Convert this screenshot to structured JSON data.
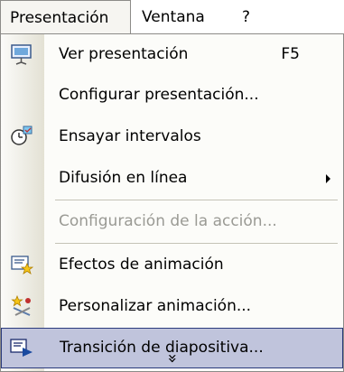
{
  "menubar": {
    "items": [
      {
        "label": "Presentación"
      },
      {
        "label": "Ventana"
      },
      {
        "label": "?"
      }
    ]
  },
  "menu": {
    "items": [
      {
        "label": "Ver presentación",
        "shortcut": "F5",
        "icon": "slideshow-icon"
      },
      {
        "label": "Configurar presentación..."
      },
      {
        "label": "Ensayar intervalos",
        "icon": "rehearse-timings-icon"
      },
      {
        "label": "Difusión en línea",
        "submenu": true
      },
      {
        "label": "Configuración de la acción...",
        "disabled": true
      },
      {
        "label": "Efectos de animación",
        "icon": "animation-effects-icon"
      },
      {
        "label": "Personalizar animación...",
        "icon": "custom-animation-icon"
      },
      {
        "label": "Transición de diapositiva...",
        "icon": "slide-transition-icon",
        "highlighted": true
      }
    ],
    "expand_glyph": "»"
  },
  "colors": {
    "highlight_bg": "#c0c4dc",
    "highlight_border": "#2a3a7c",
    "disabled_text": "#9a9a94"
  }
}
